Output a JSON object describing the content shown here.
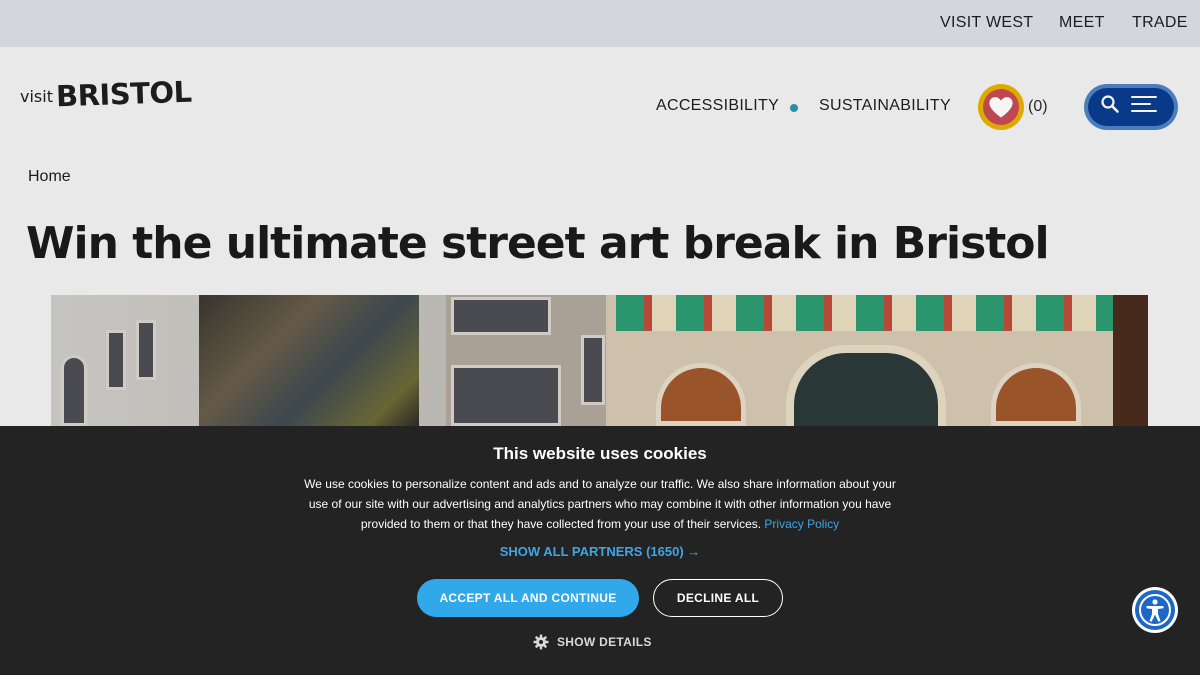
{
  "topbar": {
    "links": [
      "VISIT WEST",
      "MEET",
      "TRADE"
    ]
  },
  "header": {
    "logo": {
      "visit": "visit",
      "brand": "BRISTOL"
    },
    "nav": {
      "accessibility": "ACCESSIBILITY",
      "sustainability": "SUSTAINABILITY"
    },
    "favourites_count": "(0)",
    "icons": {
      "favourites": "heart-icon",
      "search": "search-icon",
      "menu": "hamburger-icon"
    }
  },
  "breadcrumb": {
    "home": "Home"
  },
  "page": {
    "title": "Win the ultimate street art break in Bristol"
  },
  "cookie_banner": {
    "title": "This website uses cookies",
    "body": "We use cookies to personalize content and ads and to analyze our traffic. We also share information about your use of our site with our advertising and analytics partners who may combine it with other information you have provided to them or that they have collected from your use of their services.",
    "privacy_link": "Privacy Policy",
    "partners_link": "SHOW ALL PARTNERS (1650) →",
    "accept": "ACCEPT ALL AND CONTINUE",
    "decline": "DECLINE ALL",
    "details": "SHOW DETAILS",
    "icons": {
      "details": "gear-icon"
    }
  },
  "accessibility_widget": {
    "icon": "accessibility-icon"
  },
  "colors": {
    "accent_blue": "#31a8ea",
    "menu_blue": "#0a3d8f",
    "favourite_gold": "#e7b100",
    "banner_bg": "#232323"
  }
}
